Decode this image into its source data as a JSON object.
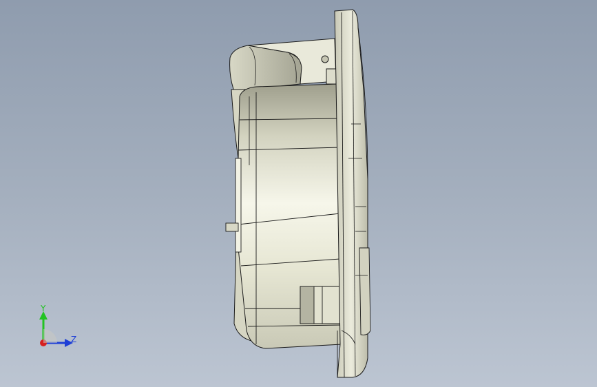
{
  "viewport": {
    "background_top": "#8f9cae",
    "background_bottom": "#bcc5d2"
  },
  "model": {
    "description_icon": "cad-part-side-view",
    "body_color": "#e6e6d4",
    "edge_color": "#1a1a1a",
    "shade_color": "#a9a996"
  },
  "triad": {
    "y_label": "Y",
    "z_label": "Z",
    "y_color": "#22c322",
    "z_color": "#1e3fd6",
    "x_color": "#d62020"
  }
}
